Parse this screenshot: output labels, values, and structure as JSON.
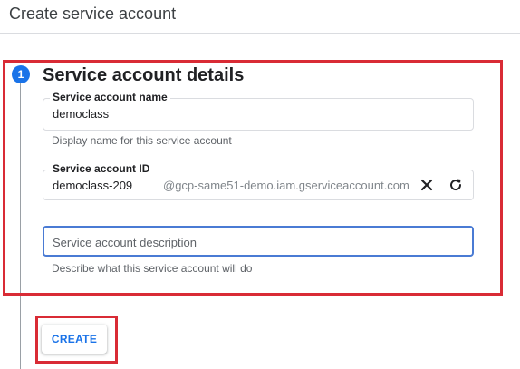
{
  "header": {
    "title": "Create service account"
  },
  "step": {
    "number": "1",
    "title": "Service account details"
  },
  "fields": {
    "name": {
      "label": "Service account name",
      "value": "democlass",
      "helper": "Display name for this service account"
    },
    "id": {
      "label": "Service account ID",
      "value": "democlass-209",
      "suffix": "@gcp-same51-demo.iam.gserviceaccount.com",
      "clear_icon": "close-icon",
      "refresh_icon": "refresh-icon"
    },
    "description": {
      "placeholder": "Service account description",
      "helper": "Describe what this service account will do"
    }
  },
  "actions": {
    "create_label": "CREATE"
  },
  "colors": {
    "accent": "#1a73e8",
    "annotation": "#d92b35",
    "focus_border": "#4a7bd4"
  }
}
